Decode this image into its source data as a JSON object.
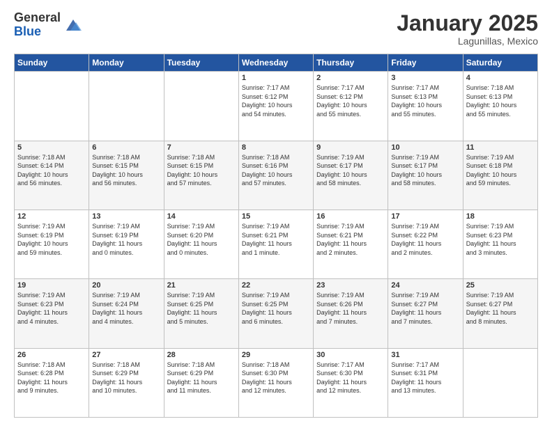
{
  "header": {
    "logo_general": "General",
    "logo_blue": "Blue",
    "month_title": "January 2025",
    "subtitle": "Lagunillas, Mexico"
  },
  "weekdays": [
    "Sunday",
    "Monday",
    "Tuesday",
    "Wednesday",
    "Thursday",
    "Friday",
    "Saturday"
  ],
  "weeks": [
    [
      {
        "day": "",
        "info": ""
      },
      {
        "day": "",
        "info": ""
      },
      {
        "day": "",
        "info": ""
      },
      {
        "day": "1",
        "info": "Sunrise: 7:17 AM\nSunset: 6:12 PM\nDaylight: 10 hours\nand 54 minutes."
      },
      {
        "day": "2",
        "info": "Sunrise: 7:17 AM\nSunset: 6:12 PM\nDaylight: 10 hours\nand 55 minutes."
      },
      {
        "day": "3",
        "info": "Sunrise: 7:17 AM\nSunset: 6:13 PM\nDaylight: 10 hours\nand 55 minutes."
      },
      {
        "day": "4",
        "info": "Sunrise: 7:18 AM\nSunset: 6:13 PM\nDaylight: 10 hours\nand 55 minutes."
      }
    ],
    [
      {
        "day": "5",
        "info": "Sunrise: 7:18 AM\nSunset: 6:14 PM\nDaylight: 10 hours\nand 56 minutes."
      },
      {
        "day": "6",
        "info": "Sunrise: 7:18 AM\nSunset: 6:15 PM\nDaylight: 10 hours\nand 56 minutes."
      },
      {
        "day": "7",
        "info": "Sunrise: 7:18 AM\nSunset: 6:15 PM\nDaylight: 10 hours\nand 57 minutes."
      },
      {
        "day": "8",
        "info": "Sunrise: 7:18 AM\nSunset: 6:16 PM\nDaylight: 10 hours\nand 57 minutes."
      },
      {
        "day": "9",
        "info": "Sunrise: 7:19 AM\nSunset: 6:17 PM\nDaylight: 10 hours\nand 58 minutes."
      },
      {
        "day": "10",
        "info": "Sunrise: 7:19 AM\nSunset: 6:17 PM\nDaylight: 10 hours\nand 58 minutes."
      },
      {
        "day": "11",
        "info": "Sunrise: 7:19 AM\nSunset: 6:18 PM\nDaylight: 10 hours\nand 59 minutes."
      }
    ],
    [
      {
        "day": "12",
        "info": "Sunrise: 7:19 AM\nSunset: 6:19 PM\nDaylight: 10 hours\nand 59 minutes."
      },
      {
        "day": "13",
        "info": "Sunrise: 7:19 AM\nSunset: 6:19 PM\nDaylight: 11 hours\nand 0 minutes."
      },
      {
        "day": "14",
        "info": "Sunrise: 7:19 AM\nSunset: 6:20 PM\nDaylight: 11 hours\nand 0 minutes."
      },
      {
        "day": "15",
        "info": "Sunrise: 7:19 AM\nSunset: 6:21 PM\nDaylight: 11 hours\nand 1 minute."
      },
      {
        "day": "16",
        "info": "Sunrise: 7:19 AM\nSunset: 6:21 PM\nDaylight: 11 hours\nand 2 minutes."
      },
      {
        "day": "17",
        "info": "Sunrise: 7:19 AM\nSunset: 6:22 PM\nDaylight: 11 hours\nand 2 minutes."
      },
      {
        "day": "18",
        "info": "Sunrise: 7:19 AM\nSunset: 6:23 PM\nDaylight: 11 hours\nand 3 minutes."
      }
    ],
    [
      {
        "day": "19",
        "info": "Sunrise: 7:19 AM\nSunset: 6:23 PM\nDaylight: 11 hours\nand 4 minutes."
      },
      {
        "day": "20",
        "info": "Sunrise: 7:19 AM\nSunset: 6:24 PM\nDaylight: 11 hours\nand 4 minutes."
      },
      {
        "day": "21",
        "info": "Sunrise: 7:19 AM\nSunset: 6:25 PM\nDaylight: 11 hours\nand 5 minutes."
      },
      {
        "day": "22",
        "info": "Sunrise: 7:19 AM\nSunset: 6:25 PM\nDaylight: 11 hours\nand 6 minutes."
      },
      {
        "day": "23",
        "info": "Sunrise: 7:19 AM\nSunset: 6:26 PM\nDaylight: 11 hours\nand 7 minutes."
      },
      {
        "day": "24",
        "info": "Sunrise: 7:19 AM\nSunset: 6:27 PM\nDaylight: 11 hours\nand 7 minutes."
      },
      {
        "day": "25",
        "info": "Sunrise: 7:19 AM\nSunset: 6:27 PM\nDaylight: 11 hours\nand 8 minutes."
      }
    ],
    [
      {
        "day": "26",
        "info": "Sunrise: 7:18 AM\nSunset: 6:28 PM\nDaylight: 11 hours\nand 9 minutes."
      },
      {
        "day": "27",
        "info": "Sunrise: 7:18 AM\nSunset: 6:29 PM\nDaylight: 11 hours\nand 10 minutes."
      },
      {
        "day": "28",
        "info": "Sunrise: 7:18 AM\nSunset: 6:29 PM\nDaylight: 11 hours\nand 11 minutes."
      },
      {
        "day": "29",
        "info": "Sunrise: 7:18 AM\nSunset: 6:30 PM\nDaylight: 11 hours\nand 12 minutes."
      },
      {
        "day": "30",
        "info": "Sunrise: 7:17 AM\nSunset: 6:30 PM\nDaylight: 11 hours\nand 12 minutes."
      },
      {
        "day": "31",
        "info": "Sunrise: 7:17 AM\nSunset: 6:31 PM\nDaylight: 11 hours\nand 13 minutes."
      },
      {
        "day": "",
        "info": ""
      }
    ]
  ]
}
